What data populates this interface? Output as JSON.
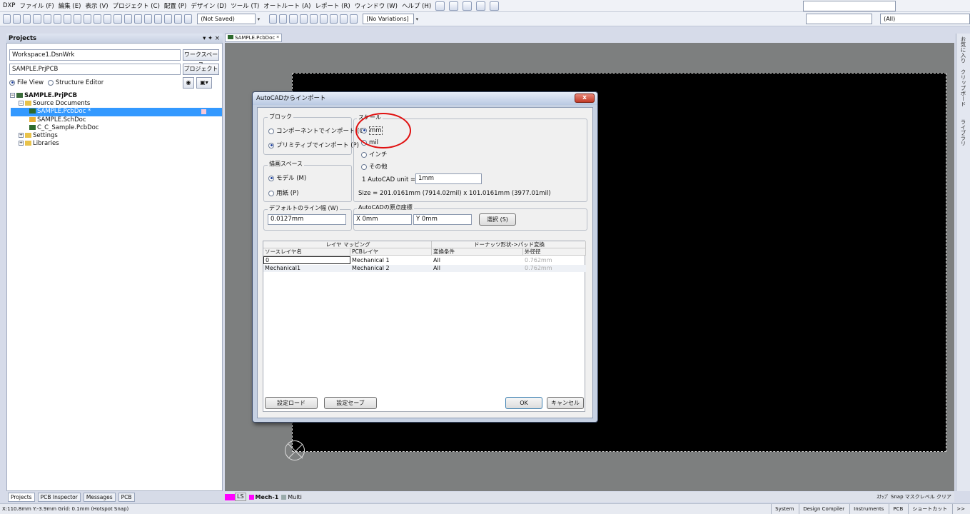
{
  "menu": [
    "DXP",
    "ファイル (F)",
    "編集 (E)",
    "表示 (V)",
    "プロジェクト (C)",
    "配置 (P)",
    "デザイン (D)",
    "ツール (T)",
    "オートルート (A)",
    "レポート (R)",
    "ウィンドウ (W)",
    "ヘルプ (H)"
  ],
  "toolbar": {
    "saved_combo": "(Not Saved)",
    "variations_combo": "[No Variations]",
    "all_combo": "(All)"
  },
  "projects_panel": {
    "title": "Projects",
    "workspace": "Workspace1.DsnWrk",
    "workspace_button": "ワークスペース",
    "project": "SAMPLE.PrjPCB",
    "project_button": "プロジェクト",
    "file_view": "File View",
    "structure_editor": "Structure Editor",
    "tree": {
      "root": "SAMPLE.PrjPCB",
      "source_documents": "Source Documents",
      "pcbdoc": "SAMPLE.PcbDoc *",
      "schdoc": "SAMPLE.SchDoc",
      "sample_pcb": "C_C_Sample.PcbDoc",
      "settings": "Settings",
      "libraries": "Libraries"
    }
  },
  "bottom_tabs": [
    "Projects",
    "PCB Inspector",
    "Messages",
    "PCB"
  ],
  "document_tab": "SAMPLE.PcbDoc *",
  "right_panels": [
    "お気に入り",
    "クリップボード",
    "ライブラリ"
  ],
  "layer_bar": {
    "ls": "LS",
    "mech1": "Mech-1",
    "multi": "Multi"
  },
  "layer_bar_right": "ｽﾅｯﾌﾟ Snap マスクレベル クリア",
  "status": {
    "left": "X:110.8mm Y:-3.9mm   Grid: 0.1mm    (Hotspot Snap)",
    "right": [
      "System",
      "Design Compiler",
      "Instruments",
      "PCB",
      "ショートカット",
      ">>"
    ]
  },
  "dialog": {
    "title": "AutoCADからインポート",
    "close": "x",
    "block": {
      "label": "ブロック",
      "component": "コンポーネントでインポート (C)",
      "primitive": "プリミティブでインポート (P)"
    },
    "scale": {
      "label": "スケール",
      "mm": "mm",
      "mil": "mil",
      "inch": "インチ",
      "other": "その他",
      "unit_label": "1 AutoCAD unit =",
      "unit_value": "1mm",
      "size": "Size = 201.0161mm (7914.02mil) x 101.0161mm (3977.01mil)"
    },
    "drawing_space": {
      "label": "描画スペース",
      "model": "モデル (M)",
      "paper": "用紙 (P)"
    },
    "default_line": {
      "label": "デフォルトのライン幅 (W)",
      "value": "0.0127mm"
    },
    "origin": {
      "label": "AutoCADの原点座標",
      "x": "X 0mm",
      "y": "Y 0mm",
      "select": "選択 (S)"
    },
    "table": {
      "group1": "レイヤ マッピング",
      "group2": "ドーナッツ形状->パッド変換",
      "columns": [
        "ソースレイヤ名",
        "PCBレイヤ",
        "変換条件",
        "外径径"
      ],
      "rows": [
        [
          "0",
          "Mechanical 1",
          "All",
          "0.762mm"
        ],
        [
          "Mechanical1",
          "Mechanical 2",
          "All",
          "0.762mm"
        ]
      ]
    },
    "load": "設定ロード",
    "save": "設定セーブ",
    "ok": "OK",
    "cancel": "キャンセル"
  }
}
